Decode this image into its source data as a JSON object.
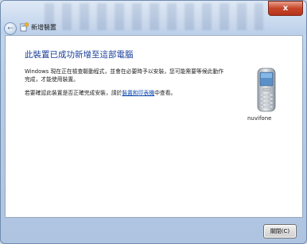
{
  "window": {
    "title": "新增裝置",
    "close_glyph": "x"
  },
  "content": {
    "heading": "此裝置已成功新增至這部電腦",
    "para1": "Windows 現在正在檢查驅動程式，並會在必要時予以安裝，您可能需要等候此動作完成，才能使用裝置。",
    "para2_prefix": "若要確認此裝置是否正確完成安裝，請於",
    "para2_link": "裝置和印表機",
    "para2_suffix": "中查看。",
    "device_name": "nuvifone"
  },
  "footer": {
    "close_label": "關閉(C)"
  },
  "icons": {
    "back": "back-arrow-icon",
    "wizard": "add-device-icon",
    "device": "mobile-phone-icon"
  }
}
